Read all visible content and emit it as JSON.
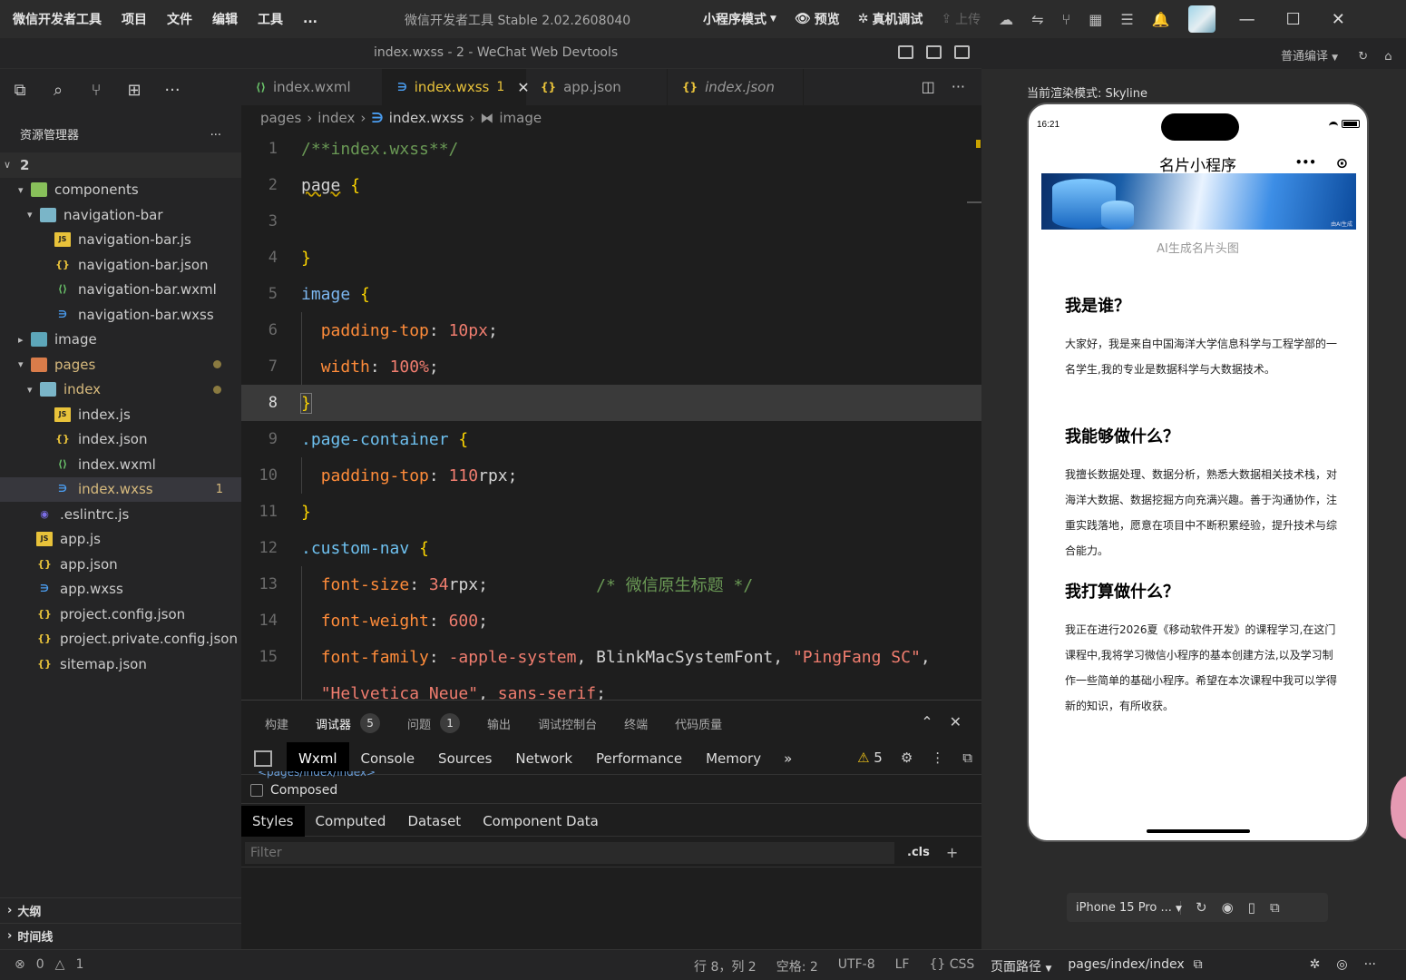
{
  "titlebar": {
    "menus": [
      "微信开发者工具",
      "项目",
      "文件",
      "编辑",
      "工具",
      "..."
    ],
    "app_title": "微信开发者工具 Stable 2.02.2608040",
    "mode": "小程序模式",
    "preview": "预览",
    "real_debug": "真机调试",
    "upload": "上传"
  },
  "subbar": {
    "title": "index.wxss - 2 - WeChat Web Devtools",
    "compile_mode": "普通编译"
  },
  "explorer": {
    "title": "资源管理器",
    "more": "...",
    "root": "2",
    "items": [
      {
        "label": "components"
      },
      {
        "label": "navigation-bar"
      },
      {
        "label": "navigation-bar.js"
      },
      {
        "label": "navigation-bar.json"
      },
      {
        "label": "navigation-bar.wxml"
      },
      {
        "label": "navigation-bar.wxss"
      },
      {
        "label": "image"
      },
      {
        "label": "pages"
      },
      {
        "label": "index"
      },
      {
        "label": "index.js"
      },
      {
        "label": "index.json"
      },
      {
        "label": "index.wxml"
      },
      {
        "label": "index.wxss",
        "badge": "1"
      },
      {
        "label": ".eslintrc.js"
      },
      {
        "label": "app.js"
      },
      {
        "label": "app.json"
      },
      {
        "label": "app.wxss"
      },
      {
        "label": "project.config.json"
      },
      {
        "label": "project.private.config.json"
      },
      {
        "label": "sitemap.json"
      }
    ],
    "outline": "大纲",
    "timeline": "时间线"
  },
  "tabs": [
    {
      "label": "index.wxml"
    },
    {
      "label": "index.wxss",
      "badge": "1"
    },
    {
      "label": "app.json"
    },
    {
      "label": "index.json"
    }
  ],
  "breadcrumb": [
    "pages",
    "index",
    "index.wxss",
    "image"
  ],
  "code": {
    "l1": "/**index.wxss**/",
    "l2_sel": "page",
    "l5_sel": "image",
    "l6_prop": "padding-top",
    "l6_val": "10px",
    "l7_prop": "width",
    "l7_val": "100%",
    "l9_sel": ".page-container",
    "l10_prop": "padding-top",
    "l10_num": "110",
    "l10_unit": "rpx",
    "l12_sel": ".custom-nav",
    "l13_prop": "font-size",
    "l13_num": "34",
    "l13_unit": "rpx",
    "l13_cm": "/* 微信原生标题 */",
    "l14_prop": "font-weight",
    "l14_val": "600",
    "l15_prop": "font-family",
    "l15_v1": "-apple-system",
    "l15_v2": "BlinkMacSystemFont",
    "l15_v3": "\"PingFang SC\"",
    "l16_v1": "\"Helvetica Neue\"",
    "l16_v2": "sans-serif"
  },
  "panel": {
    "tabs": [
      {
        "label": "构建"
      },
      {
        "label": "调试器",
        "count": "5"
      },
      {
        "label": "问题",
        "count": "1"
      },
      {
        "label": "输出"
      },
      {
        "label": "调试控制台"
      },
      {
        "label": "终端"
      },
      {
        "label": "代码质量"
      }
    ],
    "devtools": [
      "Wxml",
      "Console",
      "Sources",
      "Network",
      "Performance",
      "Memory"
    ],
    "warn_count": "5",
    "path_fragment": "<pages/index/index>",
    "composed": "Composed",
    "style_tabs": [
      "Styles",
      "Computed",
      "Dataset",
      "Component Data"
    ],
    "filter_placeholder": "Filter",
    "cls": ".cls"
  },
  "status": {
    "errors": "0",
    "warnings": "1",
    "position": "行 8，列 2",
    "spaces": "空格: 2",
    "encoding": "UTF-8",
    "eol": "LF",
    "lang": "CSS",
    "page_path_label": "页面路径",
    "page_path": "pages/index/index"
  },
  "simulator": {
    "render_mode": "当前渲染模式: Skyline",
    "time": "16:21",
    "nav_title": "名片小程序",
    "capsule_more": "•••",
    "img_watermark": "由AI生成",
    "img_caption": "AI生成名片头图",
    "sections": [
      {
        "title": "我是谁？",
        "text": "大家好，我是来自中国海洋大学信息科学与工程学部的一名学生,我的专业是数据科学与大数据技术。"
      },
      {
        "title": "我能够做什么？",
        "text": "我擅长数据处理、数据分析，熟悉大数据相关技术栈，对海洋大数据、数据挖掘方向充满兴趣。善于沟通协作，注重实践落地，愿意在项目中不断积累经验，提升技术与综合能力。"
      },
      {
        "title": "我打算做什么？",
        "text": "我正在进行2026夏《移动软件开发》的课程学习,在这门课程中,我将学习微信小程序的基本创建方法,以及学习制作一些简单的基础小程序。希望在本次课程中我可以学得新的知识，有所收获。"
      }
    ],
    "device": "iPhone 15 Pro ..."
  },
  "colors": {
    "accent": "#e8c23a",
    "selection": "#37373d",
    "background": "#1e1e1e"
  }
}
